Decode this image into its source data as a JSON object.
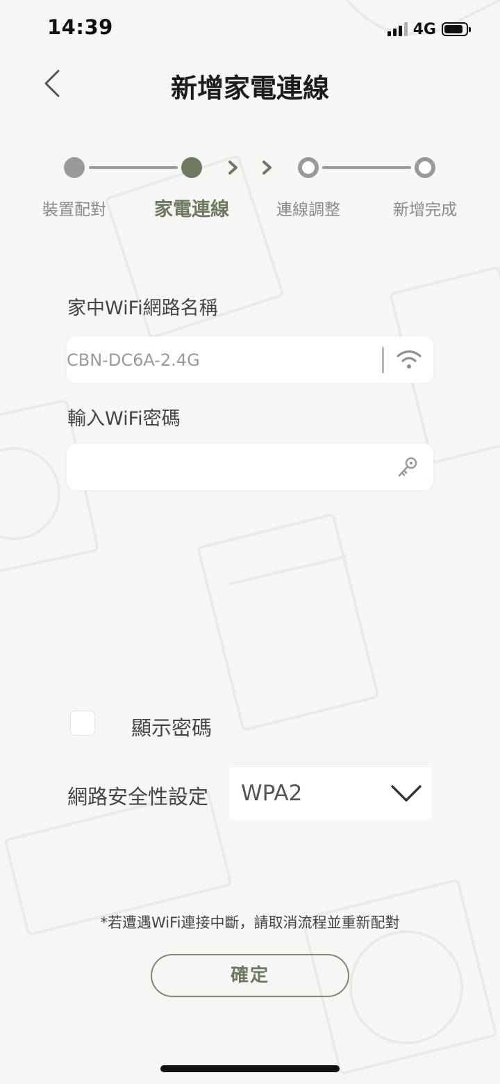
{
  "status_bar": {
    "time": "14:39",
    "network": "4G"
  },
  "header": {
    "title": "新增家電連線",
    "back_icon": "chevron-left-icon"
  },
  "stepper": {
    "steps": [
      {
        "label": "裝置配對",
        "state": "done"
      },
      {
        "label": "家電連線",
        "state": "current"
      },
      {
        "label": "連線調整",
        "state": "pending"
      },
      {
        "label": "新增完成",
        "state": "pending"
      }
    ],
    "colors": {
      "done": "#9a9a9a",
      "current": "#6e7a5f",
      "pending": "#9a9a9a"
    }
  },
  "form": {
    "ssid_label": "家中WiFi網路名稱",
    "ssid_value": "CBN-DC6A-2.4G",
    "ssid_icon": "wifi-icon",
    "password_label": "輸入WiFi密碼",
    "password_value": "",
    "password_icon": "key-icon",
    "show_password_label": "顯示密碼",
    "show_password_checked": false,
    "security_label": "網路安全性設定",
    "security_value": "WPA2",
    "security_icon": "chevron-down-icon"
  },
  "footer": {
    "note": "*若遭遇WiFi連接中斷，請取消流程並重新配對",
    "confirm_label": "確定"
  },
  "theme": {
    "accent": "#6e7a5f",
    "background": "#f6f6f5"
  }
}
